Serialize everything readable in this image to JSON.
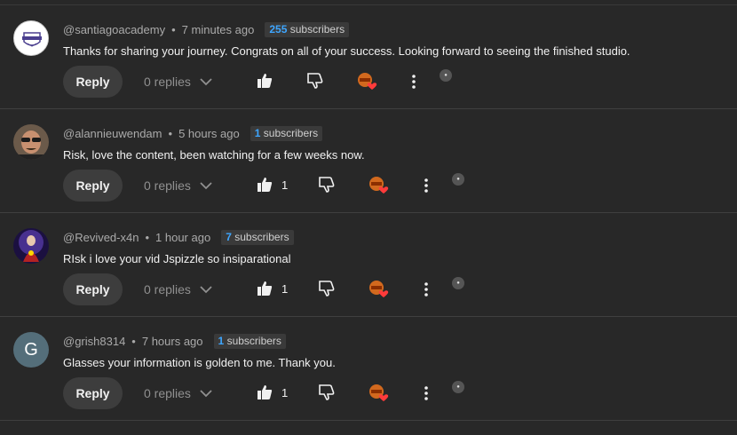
{
  "comments": [
    {
      "author": "@santiagoacademy",
      "time": "7 minutes ago",
      "subs_count": "255",
      "subs_label": "subscribers",
      "text": "Thanks for sharing your journey.  Congrats on all of your success.  Looking forward to seeing the finished studio.",
      "reply_label": "Reply",
      "replies_label": "0 replies",
      "likes": "",
      "avatar_letter": "",
      "avatar_type": "logo"
    },
    {
      "author": "@alannieuwendam",
      "time": "5 hours ago",
      "subs_count": "1",
      "subs_label": "subscribers",
      "text": "Risk, love the content, been watching for a few weeks now.",
      "reply_label": "Reply",
      "replies_label": "0 replies",
      "likes": "1",
      "avatar_letter": "",
      "avatar_type": "photo"
    },
    {
      "author": "@Revived-x4n",
      "time": "1 hour ago",
      "subs_count": "7",
      "subs_label": "subscribers",
      "text": "RIsk i love your vid Jspizzle so insiparational",
      "reply_label": "Reply",
      "replies_label": "0 replies",
      "likes": "1",
      "avatar_letter": "",
      "avatar_type": "art"
    },
    {
      "author": "@grish8314",
      "time": "7 hours ago",
      "subs_count": "1",
      "subs_label": "subscribers",
      "text": "Glasses your information is golden to me. Thank you.",
      "reply_label": "Reply",
      "replies_label": "0 replies",
      "likes": "1",
      "avatar_letter": "G",
      "avatar_type": "letter"
    }
  ],
  "colors": {
    "background": "#282828",
    "subscriber_count": "#3ea6ff",
    "heart": "#ff3b3b",
    "letter_avatar": "#546e7a"
  }
}
